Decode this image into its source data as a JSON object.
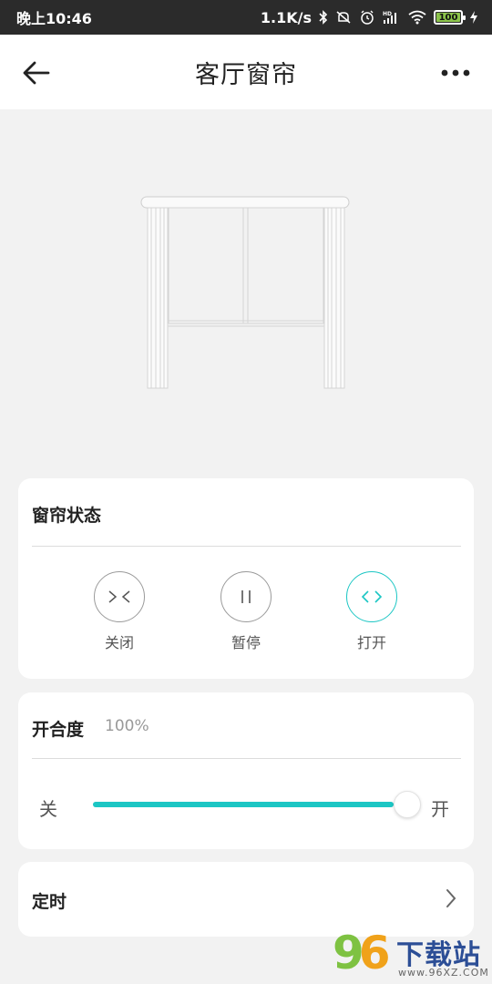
{
  "status_bar": {
    "time": "晚上10:46",
    "network_speed": "1.1K/s",
    "battery": "100",
    "hd_label": "HD",
    "icons": [
      "bluetooth-icon",
      "mute-icon",
      "alarm-icon",
      "signal-icon",
      "wifi-icon",
      "battery-icon",
      "charging-icon"
    ]
  },
  "header": {
    "title": "客厅窗帘",
    "back_icon": "arrow-left-icon",
    "more_icon": "more-dots-icon"
  },
  "curtain_status": {
    "title": "窗帘状态",
    "controls": [
      {
        "label": "关闭",
        "icon": "close-curtain-icon",
        "active": false
      },
      {
        "label": "暂停",
        "icon": "pause-icon",
        "active": false
      },
      {
        "label": "打开",
        "icon": "open-curtain-icon",
        "active": true
      }
    ]
  },
  "openness": {
    "title": "开合度",
    "value_text": "100%",
    "value": 100,
    "min_label": "关",
    "max_label": "开"
  },
  "timer": {
    "title": "定时",
    "icon": "chevron-right-icon"
  },
  "watermark": {
    "logo": "96",
    "title": "下载站",
    "url": "www.96XZ.COM"
  },
  "colors": {
    "accent": "#1cc6c4",
    "background": "#f2f2f2",
    "status_bar": "#2b2b2b"
  }
}
